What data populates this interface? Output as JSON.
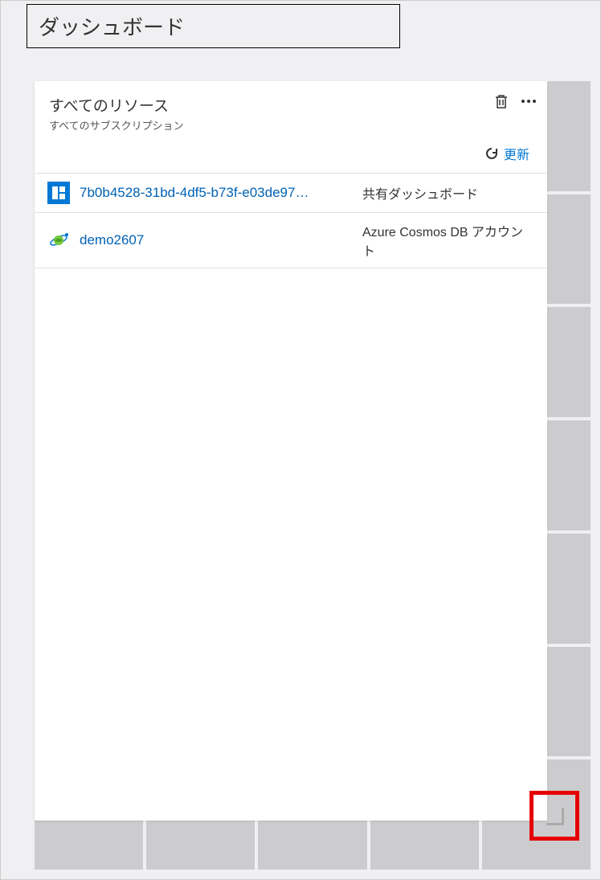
{
  "page": {
    "title": "ダッシュボード"
  },
  "tile": {
    "title": "すべてのリソース",
    "subtitle": "すべてのサブスクリプション",
    "refresh_label": "更新"
  },
  "resources": [
    {
      "name": "7b0b4528-31bd-4df5-b73f-e03de97…",
      "type": "共有ダッシュボード",
      "icon": "dashboard-icon"
    },
    {
      "name": "demo2607",
      "type": "Azure Cosmos DB アカウント",
      "icon": "cosmos-db-icon"
    }
  ]
}
